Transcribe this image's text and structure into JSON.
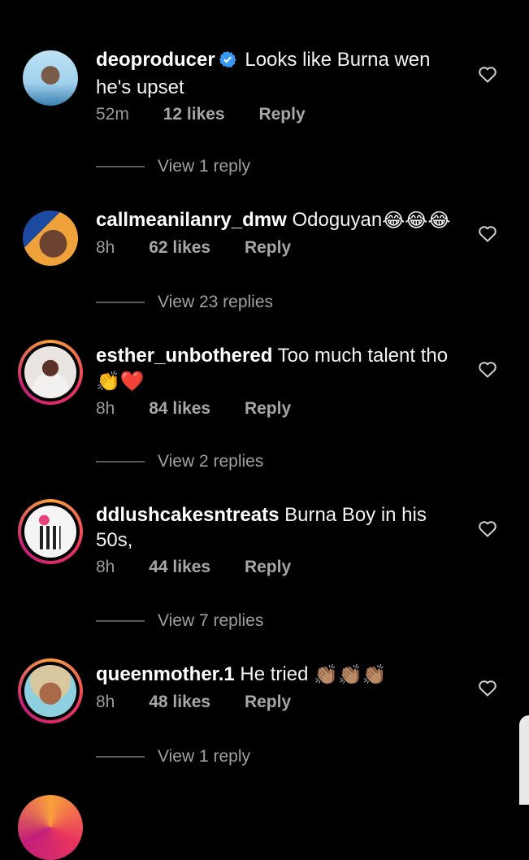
{
  "comments": [
    {
      "username": "deoproducer",
      "verified": true,
      "text": "Looks like Burna wen he's upset",
      "time": "52m",
      "likes": "12 likes",
      "reply": "Reply",
      "view_replies": "View 1 reply",
      "emojis": []
    },
    {
      "username": "callmeanilanry_dmw",
      "verified": false,
      "text": "Odoguyan",
      "time": "8h",
      "likes": "62 likes",
      "reply": "Reply",
      "view_replies": "View 23 replies",
      "emojis": [
        "😂",
        "😂",
        "😂"
      ]
    },
    {
      "username": "esther_unbothered",
      "verified": false,
      "text": "Too much talent tho",
      "time": "8h",
      "likes": "84 likes",
      "reply": "Reply",
      "view_replies": "View 2 replies",
      "emojis": [
        "👏",
        "❤️"
      ]
    },
    {
      "username": "ddlushcakesntreats",
      "verified": false,
      "text": "Burna Boy in his 50s,",
      "time": "8h",
      "likes": "44 likes",
      "reply": "Reply",
      "view_replies": "View 7 replies",
      "emojis": []
    },
    {
      "username": "queenmother.1",
      "verified": false,
      "text": "He tried",
      "time": "8h",
      "likes": "48 likes",
      "reply": "Reply",
      "view_replies": "View 1 reply",
      "emojis": [
        "👏🏽",
        "👏🏽",
        "👏🏽"
      ]
    }
  ],
  "colors": {
    "background": "#000000",
    "text": "#f2f2f2",
    "secondary": "#9a9a9a",
    "verified_badge": "#3897f0",
    "story_ring": [
      "#f9a13b",
      "#e8345f",
      "#c31e7a"
    ]
  },
  "icons": [
    "verified-icon",
    "heart-outline-icon"
  ]
}
